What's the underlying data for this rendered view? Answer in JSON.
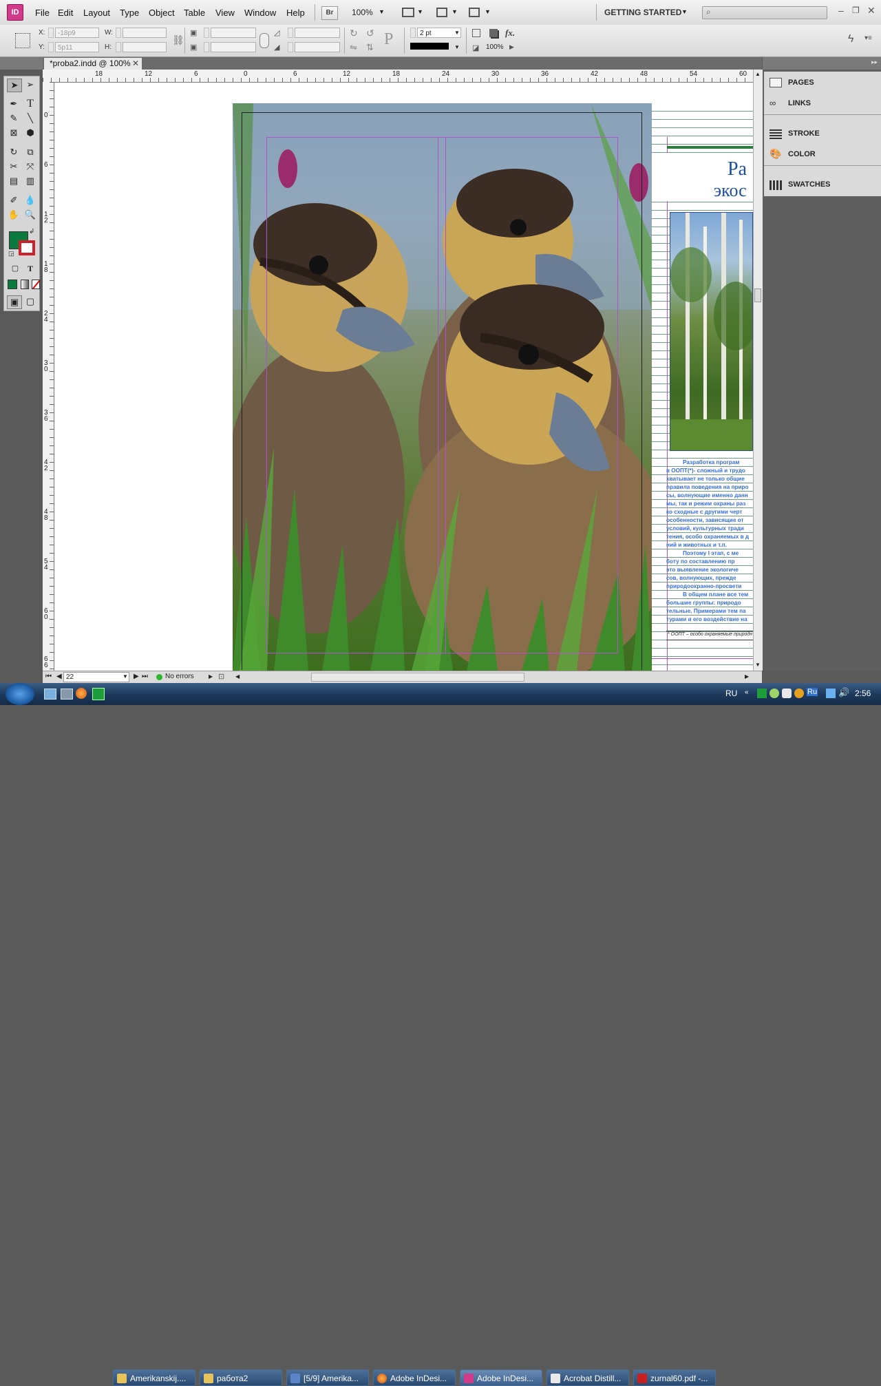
{
  "app": {
    "icon_label": "ID"
  },
  "menu": [
    "File",
    "Edit",
    "Layout",
    "Type",
    "Object",
    "Table",
    "View",
    "Window",
    "Help"
  ],
  "toolbar": {
    "bridge_label": "Br",
    "zoom": "100%",
    "workspace": "GETTING STARTED"
  },
  "control": {
    "x_label": "X:",
    "x_value": "-18p9",
    "y_label": "Y:",
    "y_value": "5p11",
    "w_label": "W:",
    "h_label": "H:",
    "stroke_weight": "2 pt",
    "opacity": "100%"
  },
  "document_tab": {
    "title": "*proba2.indd @ 100%"
  },
  "hruler_ticks": [
    "18",
    "12",
    "6",
    "0",
    "6",
    "12",
    "18",
    "24",
    "30",
    "36",
    "42",
    "48",
    "54",
    "60"
  ],
  "vruler_ticks": [
    "0",
    "6",
    "1 2",
    "1 8",
    "2 4",
    "3 0",
    "3 6",
    "4 2",
    "4 8",
    "5 4",
    "6 0",
    "6 6"
  ],
  "right_page": {
    "title_line1": "Ра",
    "title_line2": "экос",
    "body_lines": [
      "Разработка програм",
      "в ООПТ(*)- сложный и трудо",
      "хватывает не только общие",
      "правила поведения на приро",
      "сы, волнующие именно данн",
      "мы, так и режим охраны раз",
      "ко сходные с другими черт",
      "особенности, зависящие от",
      "условий, культурных тради",
      "тения, особо охраняемых в д",
      "ний и животных и т.п.",
      "Поэтому I этап, с ме",
      "боту по составлению пр",
      "это выявление экологиче",
      "сов, волнующих, прежде",
      "природоохранно-просвети",
      "В общем плане все тем",
      "большие группы: природо",
      "тельные. Примерами тем па",
      "турами и его воздействие на"
    ],
    "footnote": "* ООПТ – особо охраняемые природн"
  },
  "panels": [
    "PAGES",
    "LINKS",
    "STROKE",
    "COLOR",
    "SWATCHES"
  ],
  "status": {
    "page": "22",
    "preflight": "No errors"
  },
  "taskbar": {
    "tasks": [
      "Amerikanskij....",
      "работа2",
      "[5/9] Amerika...",
      "Adobe InDesi...",
      "Adobe InDesi...",
      "Acrobat Distill...",
      "zurnal60.pdf -..."
    ],
    "lang": "RU",
    "tray_lang": "Ru",
    "clock": "2:56"
  },
  "colors": {
    "fill_swatch": "#0b7a3e",
    "stroke_swatch": "#d0202a",
    "guide": "#b44fd0",
    "text_blue": "#3a6fd8"
  }
}
